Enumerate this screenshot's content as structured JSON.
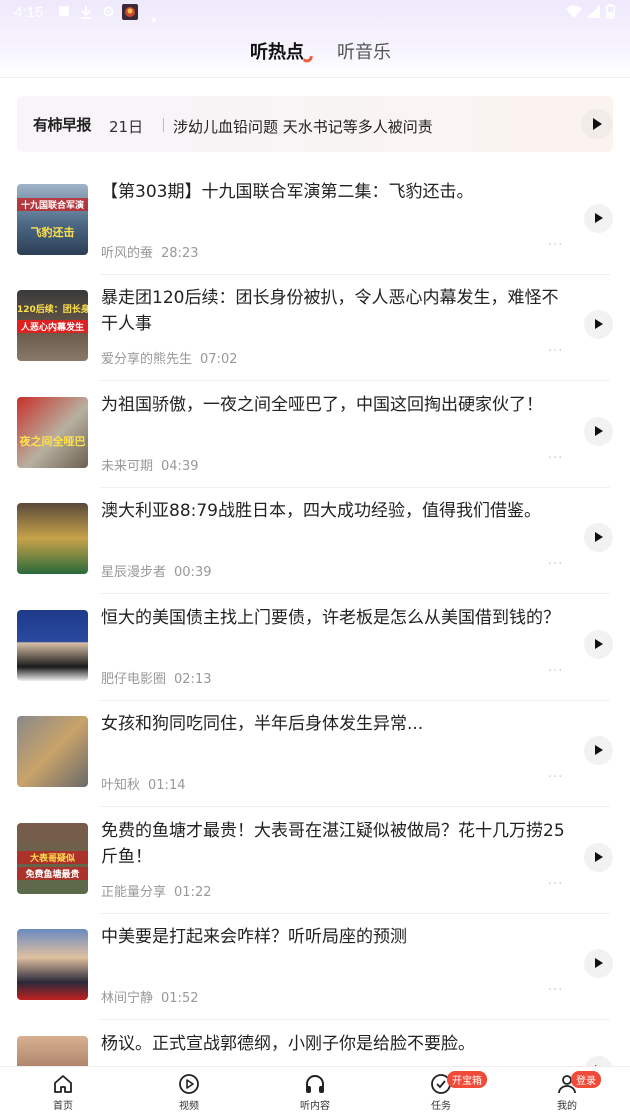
{
  "status_bar": {
    "time": "4:15"
  },
  "tabs": [
    {
      "label": "听热点",
      "active": true
    },
    {
      "label": "听音乐",
      "active": false
    }
  ],
  "brief": {
    "logo": "有柿早报",
    "date": "21日",
    "text": "涉幼儿血铅问题 天水书记等多人被问责"
  },
  "items": [
    {
      "title": "【第303期】十九国联合军演第二集：飞豹还击。",
      "author": "听风的蚕",
      "duration": "28:23",
      "thumb_caption": "十九国联合军演",
      "thumb_caption2": "飞豹还击"
    },
    {
      "title": "暴走团120后续：团长身份被扒，令人恶心内幕发生，难怪不干人事",
      "author": "爱分享的熊先生",
      "duration": "07:02",
      "thumb_caption": "120后续：团长身",
      "thumb_caption2": "人恶心内幕发生"
    },
    {
      "title": "为祖国骄傲，一夜之间全哑巴了，中国这回掏出硬家伙了！",
      "author": "未来可期",
      "duration": "04:39",
      "thumb_caption": "夜之间全哑巴"
    },
    {
      "title": "澳大利亚88:79战胜日本，四大成功经验，值得我们借鉴。",
      "author": "星辰漫步者",
      "duration": "00:39",
      "thumb_caption": ""
    },
    {
      "title": "恒大的美国债主找上门要债，许老板是怎么从美国借到钱的？",
      "author": "肥仔电影圈",
      "duration": "02:13",
      "thumb_caption": ""
    },
    {
      "title": "女孩和狗同吃同住，半年后身体发生异常...",
      "author": "叶知秋",
      "duration": "01:14",
      "thumb_caption": ""
    },
    {
      "title": "免费的鱼塘才最贵！大表哥在湛江疑似被做局？花十几万捞25斤鱼！",
      "author": "正能量分享",
      "duration": "01:22",
      "thumb_caption": "大表哥疑似",
      "thumb_caption2": "免费鱼塘最贵"
    },
    {
      "title": "中美要是打起来会咋样？听听局座的预测",
      "author": "林间宁静",
      "duration": "01:52",
      "thumb_caption": ""
    },
    {
      "title": "杨议。正式宣战郭德纲，小刚子你是给脸不要脸。",
      "author": "",
      "duration": "",
      "thumb_caption": ""
    }
  ],
  "more_glyph": "···",
  "bottom_nav": [
    {
      "label": "首页",
      "icon": "home-icon"
    },
    {
      "label": "视频",
      "icon": "play-circle-icon"
    },
    {
      "label": "听内容",
      "icon": "headphones-icon"
    },
    {
      "label": "任务",
      "icon": "check-circle-icon",
      "badge": "开宝箱"
    },
    {
      "label": "我的",
      "icon": "user-icon",
      "badge": "登录"
    }
  ],
  "colors": {
    "accent": "#f04a38",
    "header_tint": "#eee9fb"
  }
}
